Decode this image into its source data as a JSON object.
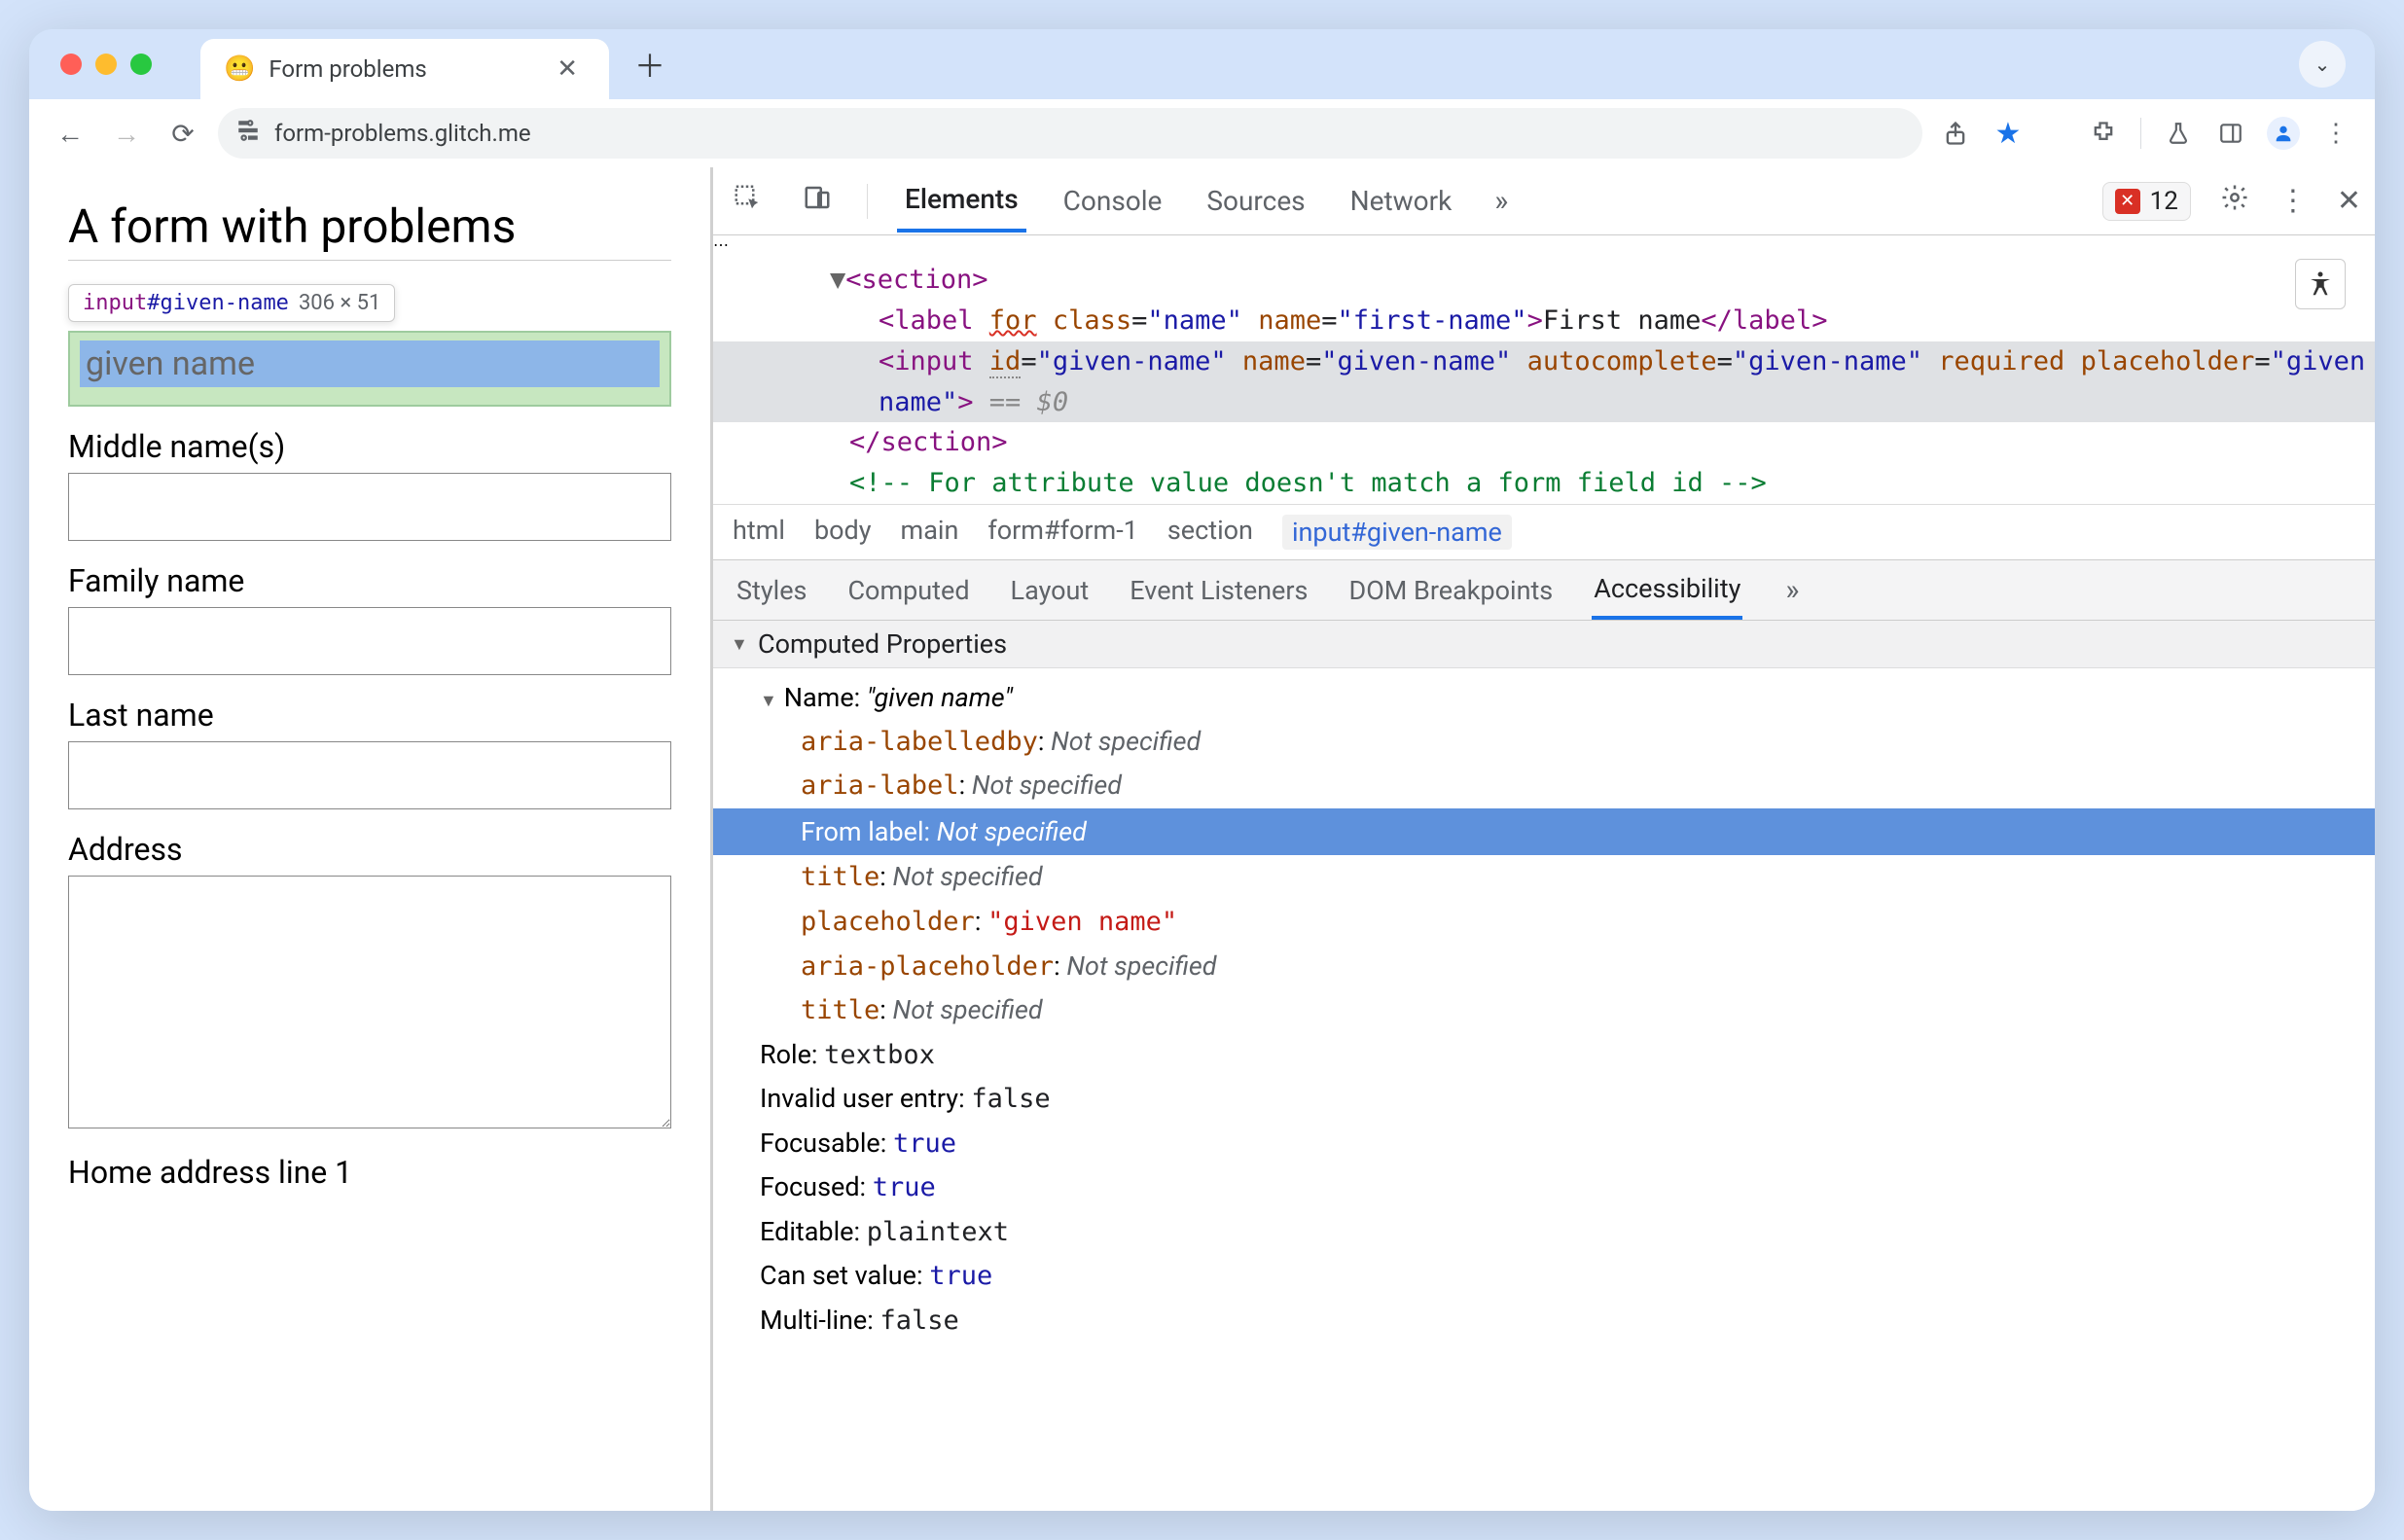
{
  "browser": {
    "tab": {
      "favicon": "😬",
      "title": "Form problems"
    },
    "url": "form-problems.glitch.me"
  },
  "page": {
    "heading": "A form with problems",
    "tooltip": {
      "tag": "input",
      "id": "#given-name",
      "dims": "306 × 51"
    },
    "inputs": {
      "first_placeholder": "given name",
      "labels": {
        "middle": "Middle name(s)",
        "family": "Family name",
        "last": "Last name",
        "address": "Address",
        "home1": "Home address line 1"
      }
    }
  },
  "devtools": {
    "tabs": {
      "elements": "Elements",
      "console": "Console",
      "sources": "Sources",
      "network": "Network"
    },
    "error_count": "12",
    "dom": {
      "l1_open": "<section>",
      "l2_label_pre": "<label ",
      "l2_for": "for",
      "l2_class_attr": "class",
      "l2_class_val": "\"name\"",
      "l2_name_attr": "name",
      "l2_name_val": "\"first-name\"",
      "l2_label_text": "First name",
      "l2_label_close": "</label>",
      "l3_input_pre": "<input ",
      "l3_id_attr": "id",
      "l3_id_val": "\"given-name\"",
      "l3_name_attr": "name",
      "l3_name_val": "\"given-name\"",
      "l3_ac_attr": "autocomplete",
      "l3_ac_val": "\"given-name\"",
      "l3_req": "required",
      "l3_ph_attr": "placeholder",
      "l3_ph_val": "\"given name\"",
      "l3_close": ">",
      "l3_ref": " == $0",
      "l4_close": "</section>",
      "l5_cmt": "<!-- For attribute value doesn't match a form field id -->"
    },
    "breadcrumb": {
      "html": "html",
      "body": "body",
      "main": "main",
      "form": "form#form-1",
      "section": "section",
      "input": "input#given-name"
    },
    "subtabs": {
      "styles": "Styles",
      "computed": "Computed",
      "layout": "Layout",
      "listeners": "Event Listeners",
      "dom_bp": "DOM Breakpoints",
      "a11y": "Accessibility"
    },
    "panel": {
      "section": "Computed Properties",
      "name_label": "Name: ",
      "name_value": "\"given name\"",
      "aria_labelledby": "aria-labelledby",
      "aria_label": "aria-label",
      "from_label": "From label: ",
      "title": "title",
      "placeholder_key": "placeholder",
      "placeholder_val": "\"given name\"",
      "aria_placeholder": "aria-placeholder",
      "not_specified": "Not specified",
      "role_label": "Role: ",
      "role_val": "textbox",
      "invalid_label": "Invalid user entry: ",
      "invalid_val": "false",
      "focusable_label": "Focusable: ",
      "focusable_val": "true",
      "focused_label": "Focused: ",
      "focused_val": "true",
      "editable_label": "Editable: ",
      "editable_val": "plaintext",
      "cansetvalue_label": "Can set value: ",
      "cansetvalue_val": "true",
      "multiline_label": "Multi-line: ",
      "multiline_val": "false"
    }
  }
}
